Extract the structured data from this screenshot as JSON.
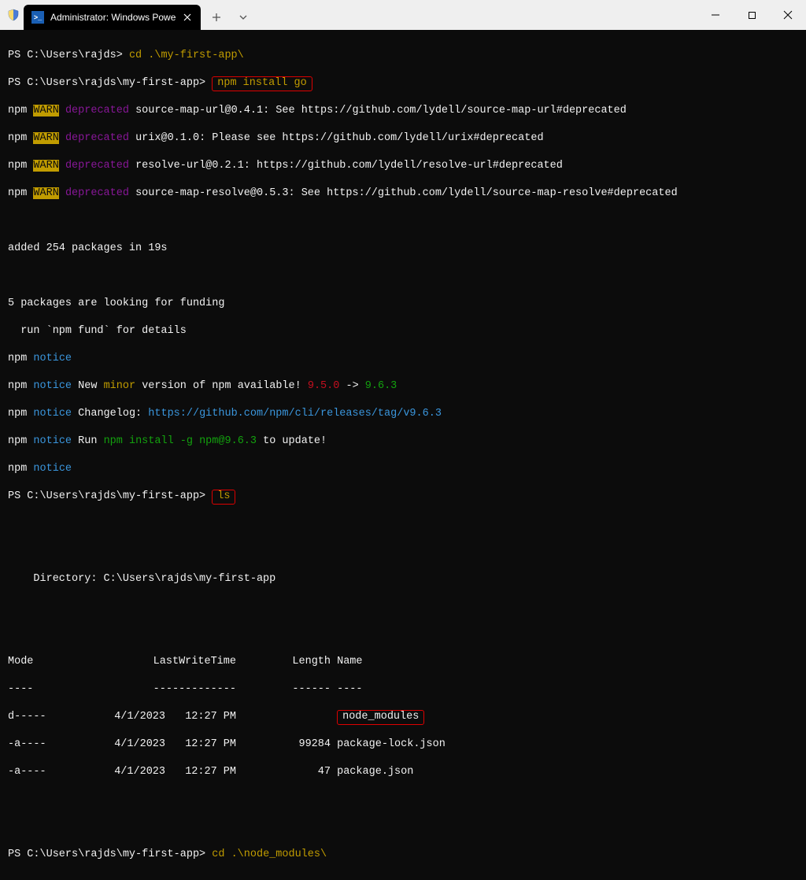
{
  "titlebar": {
    "tab_title": "Administrator: Windows Powe",
    "tab_icon_text": ">_"
  },
  "term": {
    "prompt1": "PS C:\\Users\\rajds>",
    "cmd1": "cd .\\my-first-app\\",
    "prompt2": "PS C:\\Users\\rajds\\my-first-app>",
    "cmd2": "npm install go",
    "npm": "npm",
    "warn": "WARN",
    "deprecated": "deprecated",
    "dep1": "source-map-url@0.4.1: See https://github.com/lydell/source-map-url#deprecated",
    "dep2": "urix@0.1.0: Please see https://github.com/lydell/urix#deprecated",
    "dep3": "resolve-url@0.2.1: https://github.com/lydell/resolve-url#deprecated",
    "dep4": "source-map-resolve@0.5.3: See https://github.com/lydell/source-map-resolve#deprecated",
    "added": "added 254 packages in 19s",
    "funding1": "5 packages are looking for funding",
    "funding2": "  run `npm fund` for details",
    "notice": "notice",
    "notice_new1": "New",
    "notice_minor": "minor",
    "notice_new2": "version of npm available!",
    "old_ver": "9.5.0",
    "arrow": "->",
    "new_ver": "9.6.3",
    "changelog_label": "Changelog:",
    "changelog_url": "https://github.com/npm/cli/releases/tag/v9.6.3",
    "run_label": "Run",
    "install_cmd": "npm install -g npm@9.6.3",
    "to_update": "to update!",
    "prompt3": "PS C:\\Users\\rajds\\my-first-app>",
    "cmd3": "ls",
    "dir_header": "    Directory: C:\\Users\\rajds\\my-first-app",
    "col_mode": "Mode",
    "col_lwt": "LastWriteTime",
    "col_len": "Length",
    "col_name": "Name",
    "dash_mode": "----",
    "dash_lwt": "-------------",
    "dash_len": "------",
    "dash_name": "----",
    "r1_mode": "d-----",
    "r1_date": "4/1/2023",
    "r1_time": "12:27 PM",
    "r1_len": "",
    "r1_name": "node_modules",
    "r2_mode": "-a----",
    "r2_date": "4/1/2023",
    "r2_time": "12:27 PM",
    "r2_len": "99284",
    "r2_name": "package-lock.json",
    "r3_mode": "-a----",
    "r3_date": "4/1/2023",
    "r3_time": "12:27 PM",
    "r3_len": "47",
    "r3_name": "package.json",
    "prompt4": "PS C:\\Users\\rajds\\my-first-app>",
    "cmd4": "cd .\\node_modules\\"
  }
}
